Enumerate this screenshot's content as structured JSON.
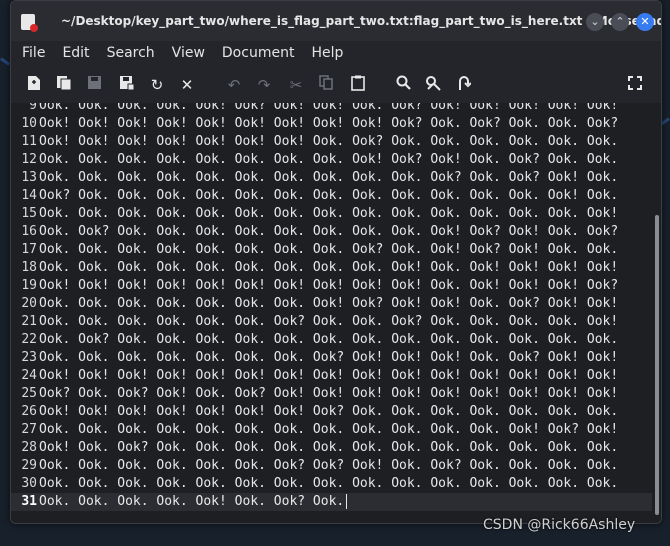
{
  "window": {
    "title": "~/Desktop/key_part_two/where_is_flag_part_two.txt:flag_part_two_is_here.txt - Mousepad"
  },
  "window_controls": {
    "minimize": "⌄",
    "maximize": "⌃",
    "close": "✕"
  },
  "menubar": {
    "items": [
      "File",
      "Edit",
      "Search",
      "View",
      "Document",
      "Help"
    ]
  },
  "toolbar": {
    "icons": [
      "new-file-icon",
      "new-window-icon",
      "save-icon",
      "save-as-icon",
      "reload-icon",
      "close-icon",
      "undo-icon",
      "redo-icon",
      "cut-icon",
      "copy-icon",
      "paste-icon",
      "search-icon",
      "replace-icon",
      "goto-line-icon",
      "fullscreen-icon"
    ]
  },
  "editor": {
    "lines": [
      {
        "n": "9",
        "text": "Ook. Ook. Ook. Ook. Ook! Ook? Ook! Ook! Ook. Ook? Ook! Ook! Ook! Ook! Ook!"
      },
      {
        "n": "10",
        "text": "Ook! Ook! Ook! Ook! Ook! Ook! Ook! Ook! Ook! Ook? Ook. Ook? Ook. Ook. Ook?"
      },
      {
        "n": "11",
        "text": "Ook! Ook! Ook! Ook! Ook! Ook! Ook! Ook. Ook? Ook. Ook. Ook. Ook. Ook. Ook."
      },
      {
        "n": "12",
        "text": "Ook. Ook. Ook. Ook. Ook. Ook. Ook. Ook. Ook! Ook? Ook! Ook. Ook? Ook. Ook."
      },
      {
        "n": "13",
        "text": "Ook. Ook. Ook. Ook. Ook. Ook. Ook. Ook. Ook. Ook. Ook? Ook. Ook? Ook! Ook."
      },
      {
        "n": "14",
        "text": "Ook? Ook. Ook. Ook. Ook. Ook. Ook. Ook. Ook. Ook. Ook. Ook. Ook. Ook! Ook."
      },
      {
        "n": "15",
        "text": "Ook. Ook. Ook. Ook. Ook. Ook. Ook. Ook. Ook. Ook. Ook. Ook. Ook. Ook. Ook!"
      },
      {
        "n": "16",
        "text": "Ook. Ook? Ook. Ook. Ook. Ook. Ook. Ook. Ook. Ook. Ook! Ook? Ook! Ook. Ook?"
      },
      {
        "n": "17",
        "text": "Ook. Ook. Ook. Ook. Ook. Ook. Ook. Ook. Ook? Ook. Ook! Ook? Ook! Ook. Ook."
      },
      {
        "n": "18",
        "text": "Ook. Ook. Ook. Ook. Ook. Ook. Ook. Ook. Ook. Ook! Ook. Ook! Ook! Ook! Ook!"
      },
      {
        "n": "19",
        "text": "Ook! Ook! Ook! Ook! Ook! Ook! Ook! Ook! Ook! Ook! Ook. Ook! Ook! Ook! Ook?"
      },
      {
        "n": "20",
        "text": "Ook. Ook. Ook. Ook. Ook. Ook. Ook. Ook! Ook? Ook! Ook! Ook. Ook? Ook! Ook!"
      },
      {
        "n": "21",
        "text": "Ook. Ook. Ook. Ook. Ook. Ook. Ook? Ook. Ook. Ook? Ook. Ook. Ook. Ook. Ook!"
      },
      {
        "n": "22",
        "text": "Ook. Ook? Ook. Ook. Ook. Ook. Ook. Ook. Ook. Ook. Ook. Ook. Ook. Ook. Ook."
      },
      {
        "n": "23",
        "text": "Ook. Ook. Ook. Ook. Ook. Ook. Ook. Ook? Ook! Ook! Ook! Ook. Ook? Ook! Ook!"
      },
      {
        "n": "24",
        "text": "Ook! Ook! Ook! Ook! Ook! Ook! Ook! Ook! Ook! Ook! Ook! Ook! Ook! Ook! Ook!"
      },
      {
        "n": "25",
        "text": "Ook? Ook. Ook? Ook! Ook. Ook? Ook! Ook! Ook! Ook! Ook! Ook! Ook! Ook! Ook!"
      },
      {
        "n": "26",
        "text": "Ook! Ook! Ook! Ook! Ook! Ook! Ook! Ook? Ook. Ook. Ook. Ook. Ook. Ook. Ook."
      },
      {
        "n": "27",
        "text": "Ook. Ook. Ook. Ook. Ook. Ook. Ook. Ook. Ook. Ook. Ook. Ook. Ook! Ook? Ook!"
      },
      {
        "n": "28",
        "text": "Ook! Ook. Ook? Ook. Ook. Ook. Ook. Ook. Ook. Ook. Ook. Ook. Ook. Ook. Ook."
      },
      {
        "n": "29",
        "text": "Ook. Ook. Ook. Ook. Ook. Ook. Ook? Ook? Ook! Ook. Ook? Ook. Ook. Ook. Ook."
      },
      {
        "n": "30",
        "text": "Ook. Ook. Ook. Ook. Ook. Ook. Ook. Ook. Ook. Ook. Ook. Ook. Ook. Ook. Ook."
      },
      {
        "n": "31",
        "text": "Ook. Ook. Ook. Ook. Ook! Ook. Ook? Ook.",
        "current": true
      }
    ]
  },
  "watermark": "CSDN @Rick66Ashley",
  "colors": {
    "accent": "#367bf0",
    "window_bg": "#23252a",
    "editor_bg": "#1d1f23"
  }
}
